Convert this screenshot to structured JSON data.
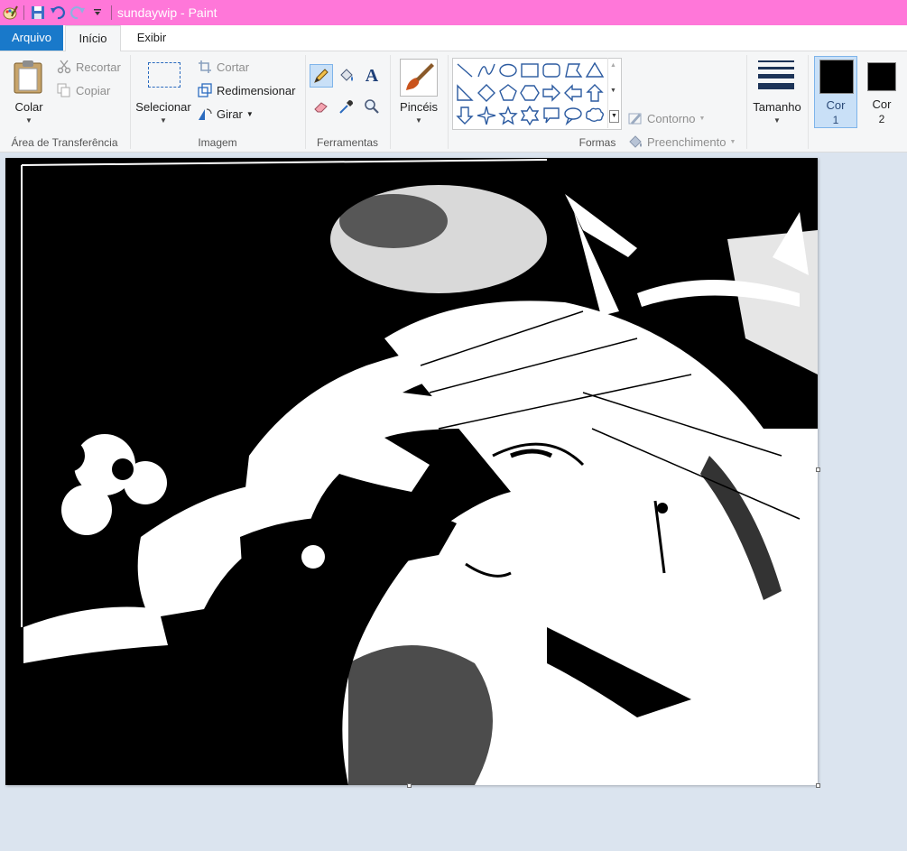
{
  "window": {
    "title": "sundaywip - Paint",
    "title_bar_color": "#ff77d9"
  },
  "tabs": [
    {
      "label": "Arquivo"
    },
    {
      "label": "Início"
    },
    {
      "label": "Exibir"
    }
  ],
  "clipboard": {
    "group_label": "Área de Transferência",
    "paste_label": "Colar",
    "cut_label": "Recortar",
    "copy_label": "Copiar"
  },
  "image": {
    "group_label": "Imagem",
    "select_label": "Selecionar",
    "crop_label": "Cortar",
    "resize_label": "Redimensionar",
    "rotate_label": "Girar"
  },
  "tools": {
    "group_label": "Ferramentas",
    "active_tool": "pencil-icon"
  },
  "brushes": {
    "label": "Pincéis"
  },
  "shapes": {
    "group_label": "Formas",
    "outline_label": "Contorno",
    "fill_label": "Preenchimento"
  },
  "size": {
    "label": "Tamanho"
  },
  "colors": {
    "color1_label": "Cor",
    "color1_num": "1",
    "color1_value": "#000000",
    "color2_label": "Cor",
    "color2_num": "2",
    "color2_value": "#000000"
  }
}
